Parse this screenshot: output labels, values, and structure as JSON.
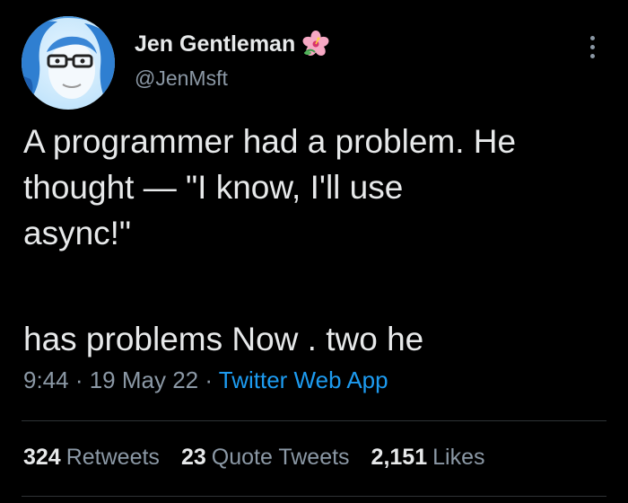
{
  "author": {
    "display_name": "Jen Gentleman",
    "handle": "@JenMsft",
    "avatar_icon": "profile-photo",
    "badge_icon": "hibiscus-flower-icon"
  },
  "tweet": {
    "line1": "A programmer had a problem. He",
    "line2": "thought  — \"I know, I'll use",
    "line3": "async!\"",
    "line4": "has problems Now . two he"
  },
  "meta": {
    "time": "9:44",
    "separator1": " · ",
    "date": "19 May 22",
    "separator2": " · ",
    "source": "Twitter Web App"
  },
  "stats": {
    "retweets_count": "324",
    "retweets_label": "Retweets",
    "quotes_count": "23",
    "quotes_label": "Quote Tweets",
    "likes_count": "2,151",
    "likes_label": "Likes"
  },
  "colors": {
    "background": "#000000",
    "text": "#e7e9ea",
    "secondary": "#8b98a5",
    "link": "#1d9bf0",
    "divider": "#2f3336"
  }
}
